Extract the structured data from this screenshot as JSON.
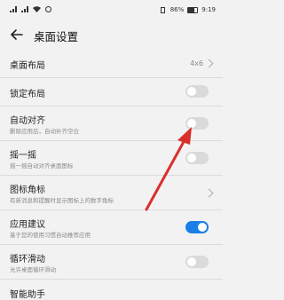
{
  "status_bar": {
    "battery": "86%",
    "time": "9:19"
  },
  "header": {
    "title": "桌面设置"
  },
  "rows": [
    {
      "label": "桌面布局",
      "value": "4x6",
      "control": "chevron"
    },
    {
      "label": "锁定布局",
      "control": "toggle",
      "on": false
    },
    {
      "label": "自动对齐",
      "sub": "删除应用后，自动补齐空位",
      "control": "toggle",
      "on": false
    },
    {
      "label": "摇一摇",
      "sub": "摇一摇自动对齐桌面图标",
      "control": "toggle",
      "on": false
    },
    {
      "label": "图标角标",
      "sub": "有新消息和提醒时显示图标上的数字角标",
      "control": "chevron"
    },
    {
      "label": "应用建议",
      "sub": "基于您的使用习惯自动推荐应用",
      "control": "toggle",
      "on": true
    },
    {
      "label": "循环滑动",
      "sub": "允许桌面循环滑动",
      "control": "toggle",
      "on": false
    },
    {
      "label": "智能助手"
    }
  ],
  "colors": {
    "accent": "#1a7fe8",
    "annotation_arrow": "#d9302b"
  }
}
